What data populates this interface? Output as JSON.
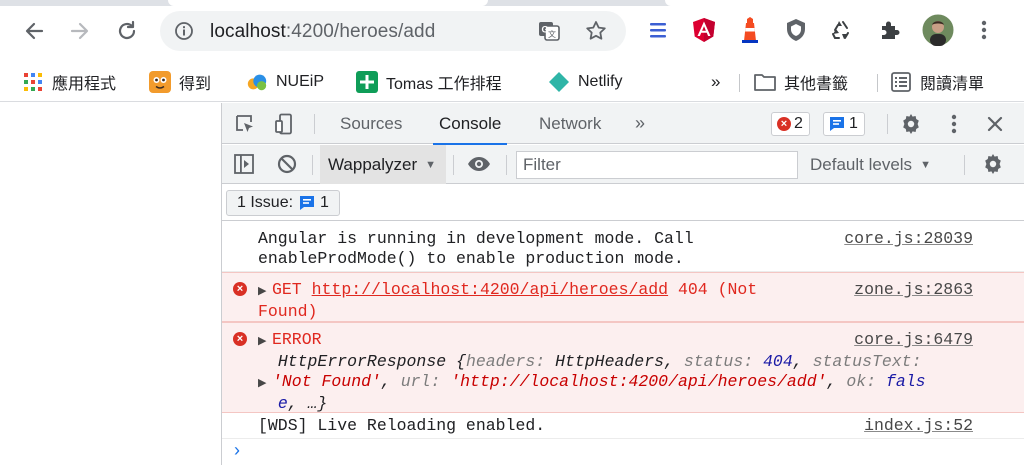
{
  "browser": {
    "url_host": "localhost",
    "url_path": ":4200/heroes/add",
    "colors": {
      "omnibox_bg": "#f1f3f4",
      "accent": "#1a73e8"
    },
    "nav_icons": [
      "back-arrow-icon",
      "forward-arrow-icon",
      "reload-icon",
      "info-icon"
    ],
    "omnibox_icons": [
      "translate-icon",
      "star-icon"
    ],
    "extensions": [
      "tab-search-icon",
      "angular-devtools-icon",
      "lighthouse-icon",
      "shield-icon",
      "recycle-icon",
      "extensions-puzzle-icon",
      "profile-avatar",
      "kebab-menu-icon"
    ]
  },
  "bookmarks": {
    "items": [
      {
        "label": "應用程式",
        "icon": "apps-grid-icon"
      },
      {
        "label": "得到",
        "icon": "dedao-icon"
      },
      {
        "label": "NUEiP",
        "icon": "nueip-cloud-icon"
      },
      {
        "label": "Tomas 工作排程",
        "icon": "green-plus-icon"
      },
      {
        "label": "Netlify",
        "icon": "netlify-diamond-icon"
      }
    ],
    "overflow": "»",
    "other": "其他書籤",
    "reading_list": "閱讀清單"
  },
  "devtools": {
    "tabs": [
      "Sources",
      "Console",
      "Network"
    ],
    "active_tab": "Console",
    "more_tabs": "»",
    "error_count": "2",
    "message_count": "1",
    "context": "Wappalyzer",
    "filter_placeholder": "Filter",
    "levels": "Default levels",
    "issues_label": "1 Issue:",
    "issues_count": "1"
  },
  "console": {
    "messages": [
      {
        "level": "info",
        "line1": "Angular is running in development mode. Call",
        "line2": "enableProdMode() to enable production mode.",
        "source": "core.js:28039"
      },
      {
        "level": "error",
        "method": "GET",
        "url": "http://localhost:4200/api/heroes/add",
        "status": "404 (Not",
        "status_end": "Found)",
        "source": "zone.js:2863"
      },
      {
        "level": "error",
        "label": "ERROR",
        "object_name": "HttpErrorResponse",
        "source": "core.js:6479",
        "props": {
          "headers": "HttpHeaders",
          "status": "404",
          "statusText": "'Not Found'",
          "url": "'http://localhost:4200/api/heroes/add'",
          "ok": "fals",
          "ok_end": "e"
        }
      },
      {
        "level": "info",
        "line1": "[WDS] Live Reloading enabled.",
        "source": "index.js:52"
      }
    ],
    "prompt": "›"
  }
}
